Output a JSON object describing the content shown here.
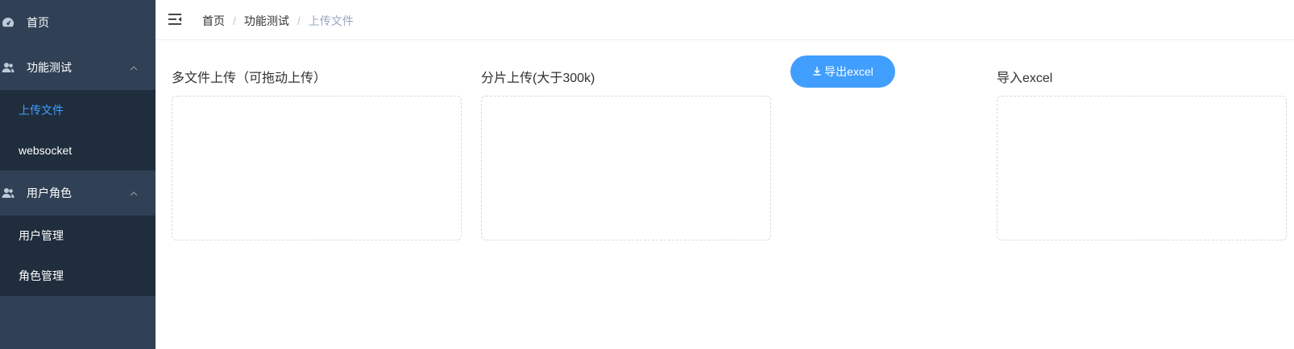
{
  "sidebar": {
    "home": "首页",
    "group_test": {
      "label": "功能测试",
      "items": [
        "上传文件",
        "websocket"
      ]
    },
    "group_user": {
      "label": "用户角色",
      "items": [
        "用户管理",
        "角色管理"
      ]
    }
  },
  "topbar": {
    "breadcrumb": [
      "首页",
      "功能测试",
      "上传文件"
    ],
    "separator": "/"
  },
  "main": {
    "multi_upload_title": "多文件上传（可拖动上传）",
    "chunk_upload_title": "分片上传(大于300k)",
    "export_button": "导出excel",
    "import_title": "导入excel"
  },
  "colors": {
    "sidebar_bg": "#304156",
    "submenu_bg": "#1f2d3d",
    "accent": "#409eff"
  }
}
